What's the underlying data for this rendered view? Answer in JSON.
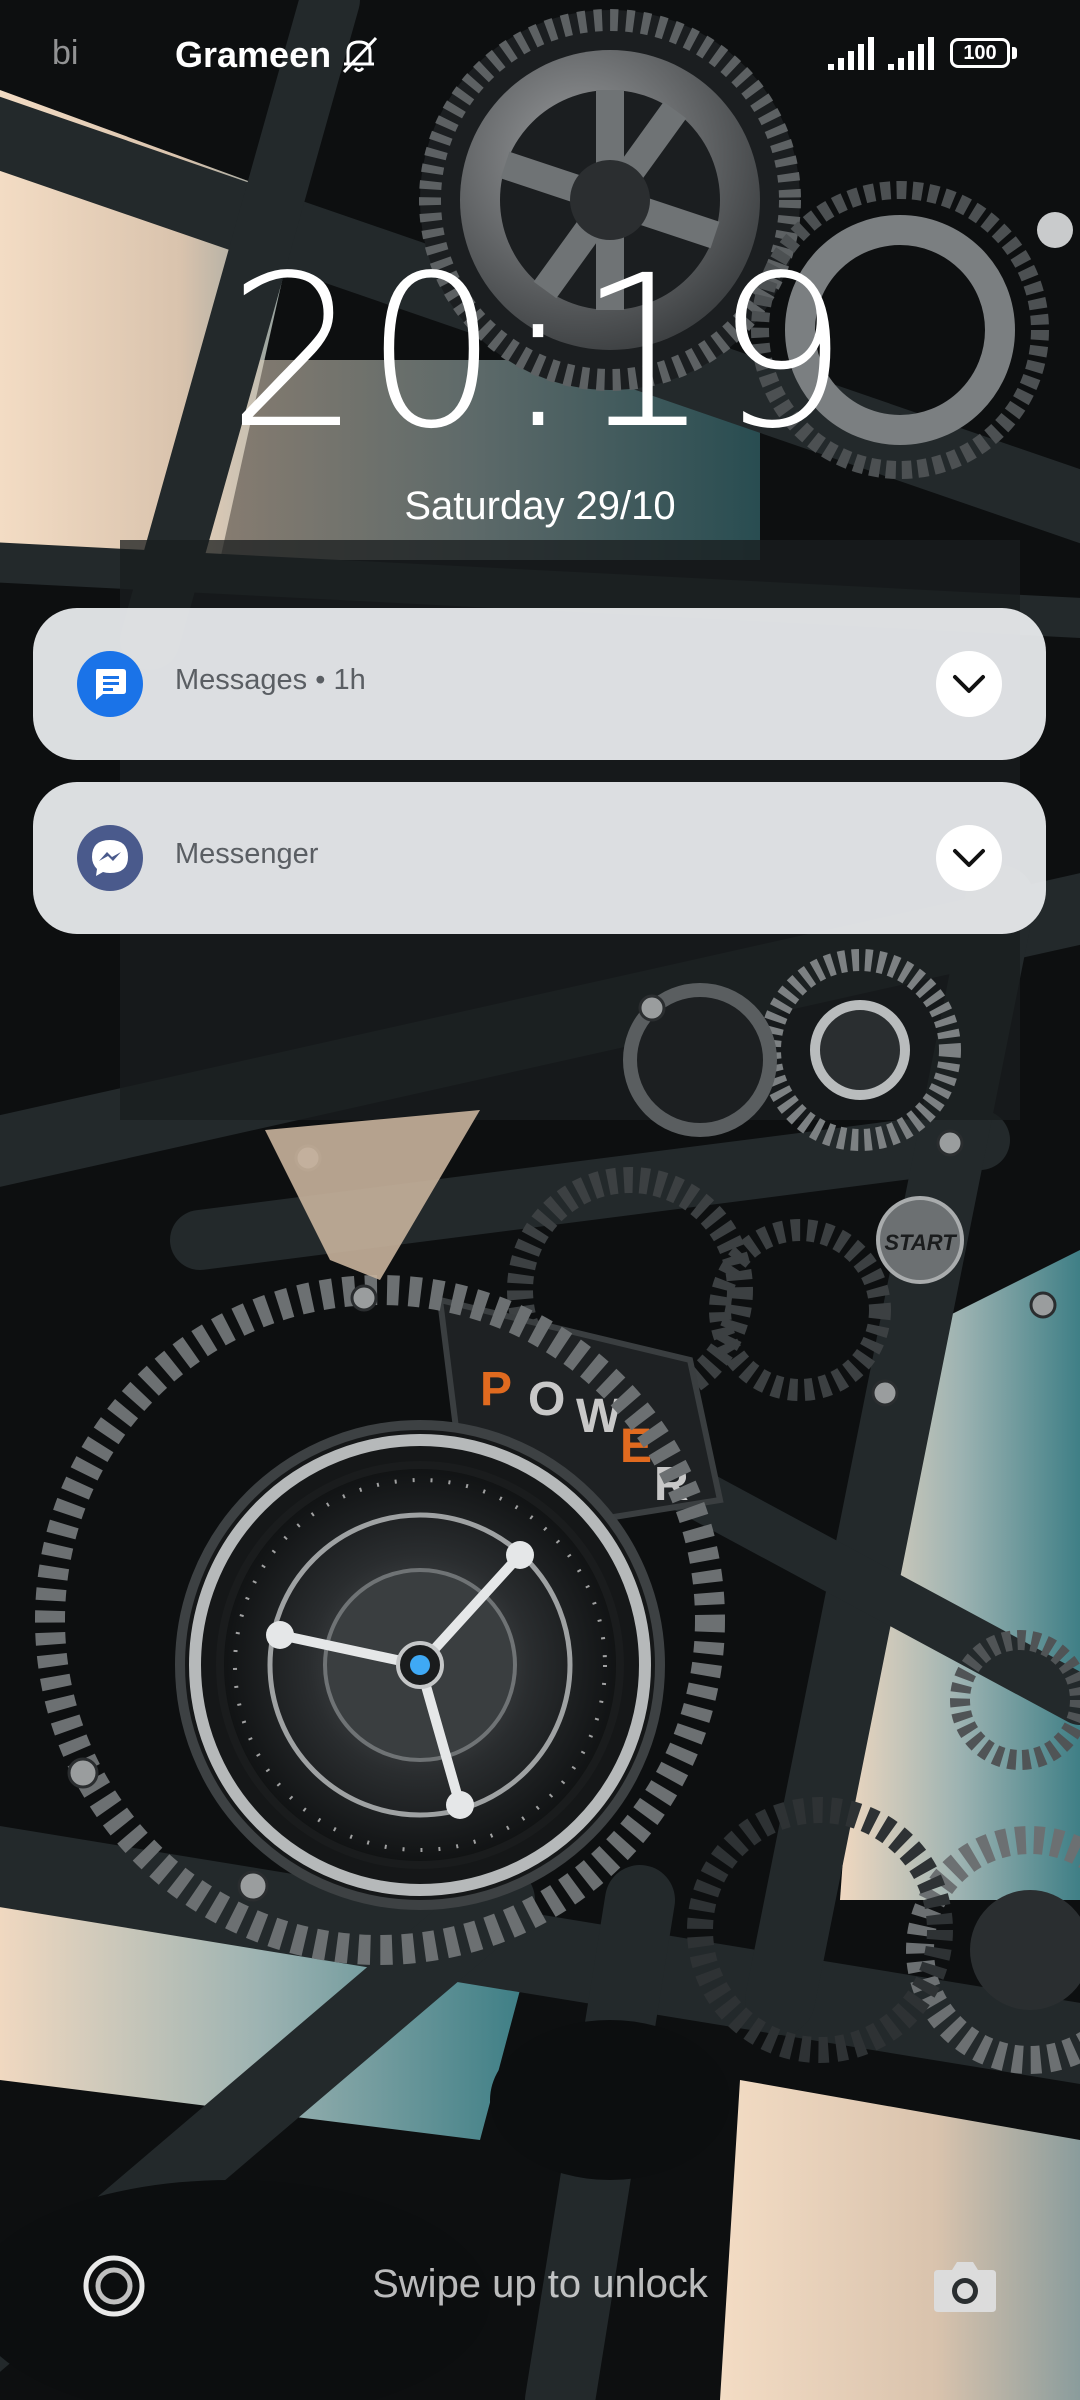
{
  "status_bar": {
    "carrier_1": "bi",
    "carrier_2": "Grameen",
    "battery_level": "100",
    "icons": [
      "bell-off-icon",
      "signal-icon",
      "signal-icon",
      "battery-icon"
    ]
  },
  "lock_screen": {
    "time": "20:19",
    "date": "Saturday 29/10"
  },
  "notifications": [
    {
      "app": "Messages",
      "time": "1h",
      "icon": "messages-icon",
      "color": "#1a73e8"
    },
    {
      "app": "Messenger",
      "icon": "messenger-icon",
      "color": "#4a5a8c"
    }
  ],
  "bottom": {
    "hint": "Swipe up to unlock",
    "left_icon": "target-icon",
    "right_icon": "camera-icon"
  }
}
